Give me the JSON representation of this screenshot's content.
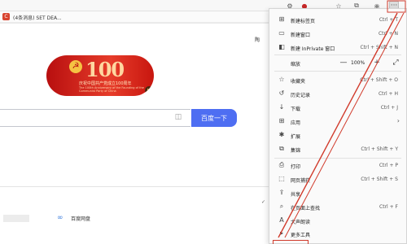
{
  "bookmark": {
    "favicon": "C",
    "label": "(4条消息) SET DEA..."
  },
  "toolbar": {
    "icons": [
      "settings-icon",
      "badge-icon",
      "favorites-star-icon",
      "collections-icon",
      "profile-icon",
      "more-icon"
    ],
    "badge": "",
    "more": "···"
  },
  "page": {
    "clip_text": "陶",
    "banner_title": "庆祝中国共产党成立100周年",
    "banner_sub": "The 100th Anniversary of the Founding of the Communist Party of China",
    "banner_number": "100",
    "search_button": "百度一下",
    "wangpan": "百度网盘",
    "tick": "✓ 〈"
  },
  "menu": {
    "items_top": [
      {
        "icon": "new-tab-icon",
        "label": "新建标签页",
        "shortcut": "Ctrl + T"
      },
      {
        "icon": "new-window-icon",
        "label": "新建窗口",
        "shortcut": "Ctrl + N"
      },
      {
        "icon": "inprivate-icon",
        "label": "新建 InPrivate 窗口",
        "shortcut": "Ctrl + Shift + N"
      }
    ],
    "zoom": {
      "label": "缩放",
      "minus": "—",
      "value": "100%",
      "plus": "+",
      "full": "⤢"
    },
    "items_mid": [
      {
        "icon": "favorites-icon",
        "label": "收藏夹",
        "shortcut": "Ctrl + Shift + O"
      },
      {
        "icon": "history-icon",
        "label": "历史记录",
        "shortcut": "Ctrl + H"
      },
      {
        "icon": "download-icon",
        "label": "下载",
        "shortcut": "Ctrl + J"
      },
      {
        "icon": "apps-icon",
        "label": "应用",
        "shortcut": ""
      },
      {
        "icon": "extensions-icon",
        "label": "扩展",
        "shortcut": ""
      },
      {
        "icon": "collections-icon",
        "label": "集锦",
        "shortcut": "Ctrl + Shift + Y"
      }
    ],
    "items_bottom": [
      {
        "icon": "print-icon",
        "label": "打印",
        "shortcut": "Ctrl + P"
      },
      {
        "icon": "web-capture-icon",
        "label": "网页捕获",
        "shortcut": "Ctrl + Shift + S"
      },
      {
        "icon": "share-icon",
        "label": "共享",
        "shortcut": ""
      },
      {
        "icon": "find-icon",
        "label": "在页面上查找",
        "shortcut": "Ctrl + F"
      },
      {
        "icon": "read-aloud-icon",
        "label": "大声朗读",
        "shortcut": ""
      },
      {
        "icon": "more-tools-icon",
        "label": "更多工具",
        "shortcut": ""
      }
    ],
    "apps_chevron": "›"
  },
  "colors": {
    "accent": "#4e6ef2",
    "annotation": "#d13b2c",
    "banner": "#c8160f"
  }
}
